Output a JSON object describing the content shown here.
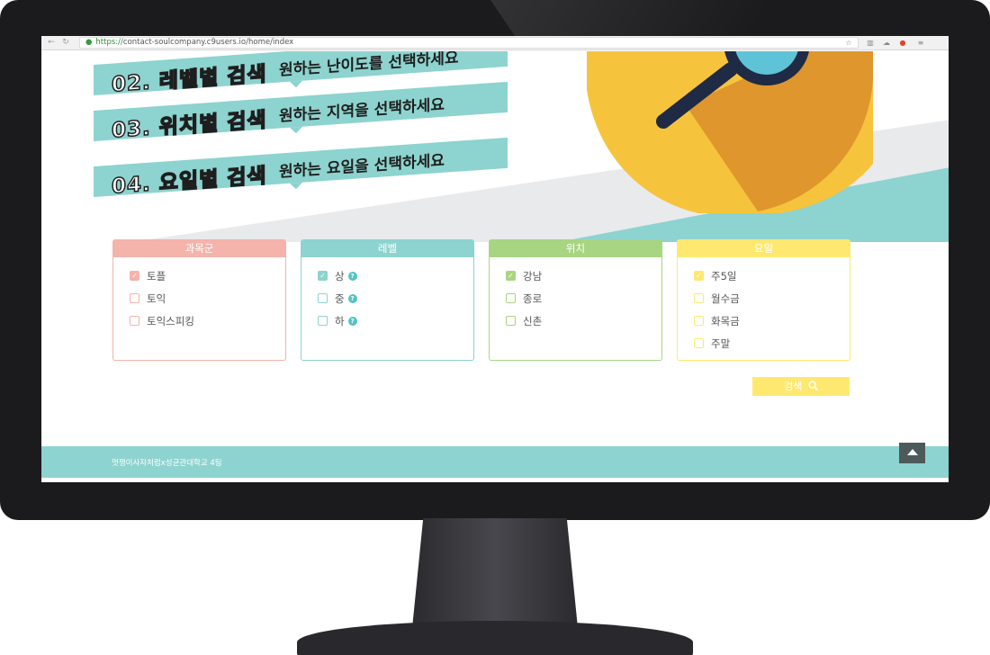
{
  "browser": {
    "url_scheme": "https://",
    "url_host": "contact-soulcompany.c9users.io",
    "url_path": "/home/index"
  },
  "hero": {
    "banners": [
      {
        "num": "02. 레벨별 검색",
        "desc": "원하는 난이도를 선택하세요"
      },
      {
        "num": "03. 위치별 검색",
        "desc": "원하는 지역을 선택하세요"
      },
      {
        "num": "04. 요일별 검색",
        "desc": "원하는 요일을 선택하세요"
      }
    ]
  },
  "filters": [
    {
      "title": "과목군",
      "color": "#f4b3ab",
      "items": [
        {
          "label": "토플",
          "checked": true
        },
        {
          "label": "토익",
          "checked": false
        },
        {
          "label": "토익스피킹",
          "checked": false
        }
      ]
    },
    {
      "title": "레벨",
      "color": "#8dd3cf",
      "items": [
        {
          "label": "상",
          "checked": true,
          "help": "?"
        },
        {
          "label": "중",
          "checked": false,
          "help": "?"
        },
        {
          "label": "하",
          "checked": false,
          "help": "?"
        }
      ]
    },
    {
      "title": "위치",
      "color": "#a8d581",
      "items": [
        {
          "label": "강남",
          "checked": true
        },
        {
          "label": "종로",
          "checked": false
        },
        {
          "label": "신촌",
          "checked": false
        }
      ]
    },
    {
      "title": "요일",
      "color": "#ffe870",
      "items": [
        {
          "label": "주5일",
          "checked": true
        },
        {
          "label": "월수금",
          "checked": false
        },
        {
          "label": "화목금",
          "checked": false
        },
        {
          "label": "주말",
          "checked": false
        }
      ]
    }
  ],
  "search": {
    "label": "검색",
    "icon": "search-icon"
  },
  "footer": {
    "text": "멋쟁이사자처럼x성균관대학교 4팀",
    "top_icon": "arrow-up-icon"
  },
  "colors": {
    "teal": "#8dd3cf",
    "monitor": "#1b1b1e"
  }
}
